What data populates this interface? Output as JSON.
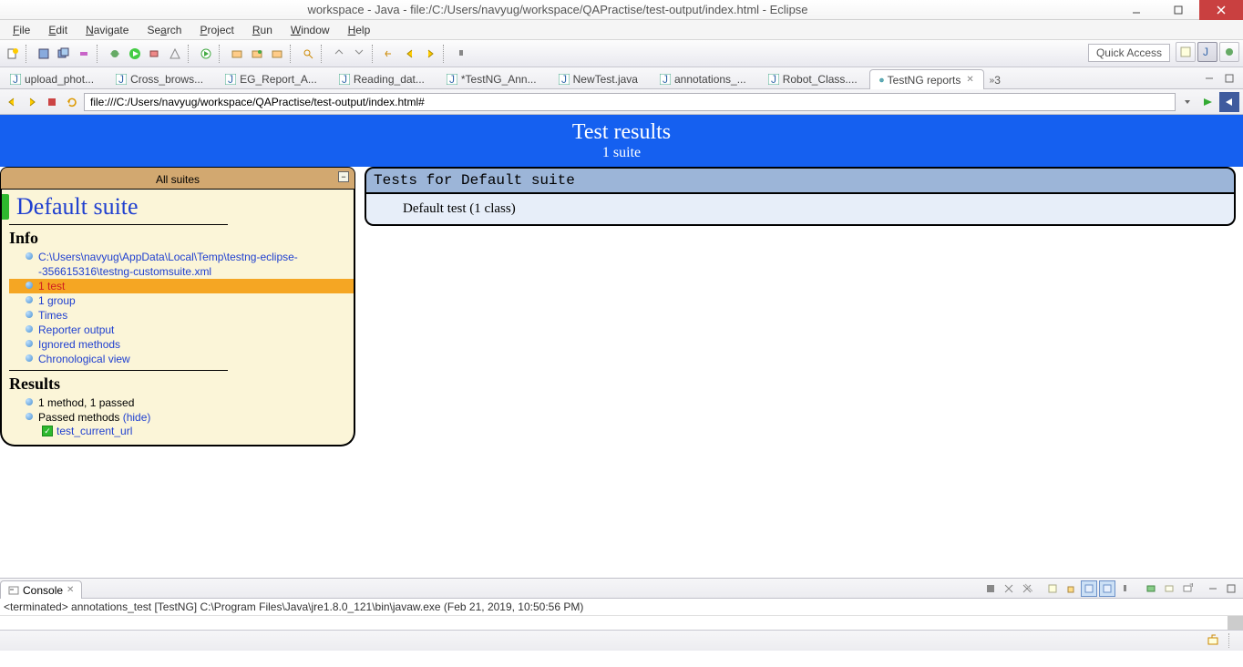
{
  "window": {
    "title": "workspace - Java - file:/C:/Users/navyug/workspace/QAPractise/test-output/index.html - Eclipse"
  },
  "menu": {
    "items": [
      "File",
      "Edit",
      "Navigate",
      "Search",
      "Project",
      "Run",
      "Window",
      "Help"
    ]
  },
  "quick_access": "Quick Access",
  "editor_tabs": [
    {
      "label": "upload_phot...",
      "type": "java"
    },
    {
      "label": "Cross_brows...",
      "type": "java"
    },
    {
      "label": "EG_Report_A...",
      "type": "java"
    },
    {
      "label": "Reading_dat...",
      "type": "java"
    },
    {
      "label": "*TestNG_Ann...",
      "type": "java"
    },
    {
      "label": "NewTest.java",
      "type": "java"
    },
    {
      "label": "annotations_...",
      "type": "java"
    },
    {
      "label": "Robot_Class....",
      "type": "java"
    },
    {
      "label": "TestNG reports",
      "type": "world",
      "active": true
    }
  ],
  "tab_overflow": "»₃",
  "url": "file:///C:/Users/navyug/workspace/QAPractise/test-output/index.html#",
  "report": {
    "header_title": "Test results",
    "header_sub": "1 suite",
    "all_suites": "All suites",
    "suite_name": "Default suite",
    "info_heading": "Info",
    "info_items": [
      {
        "text": "C:\\Users\\navyug\\AppData\\Local\\Temp\\testng-eclipse--356615316\\testng-customsuite.xml",
        "link": true
      },
      {
        "text": "1 test",
        "link": true,
        "red": true,
        "selected": true
      },
      {
        "text": "1 group",
        "link": true
      },
      {
        "text": "Times",
        "link": true
      },
      {
        "text": "Reporter output",
        "link": true
      },
      {
        "text": "Ignored methods",
        "link": true
      },
      {
        "text": "Chronological view",
        "link": true
      }
    ],
    "results_heading": "Results",
    "results_items": [
      {
        "text": "1 method, 1 passed"
      },
      {
        "text": "Passed methods ",
        "hide": "(hide)"
      }
    ],
    "passed_test": "test_current_url",
    "tests_for": "Tests for Default suite",
    "default_test": "Default test (1 class)"
  },
  "console": {
    "tab": "Console",
    "info": "<terminated> annotations_test [TestNG] C:\\Program Files\\Java\\jre1.8.0_121\\bin\\javaw.exe (Feb 21, 2019, 10:50:56 PM)"
  }
}
